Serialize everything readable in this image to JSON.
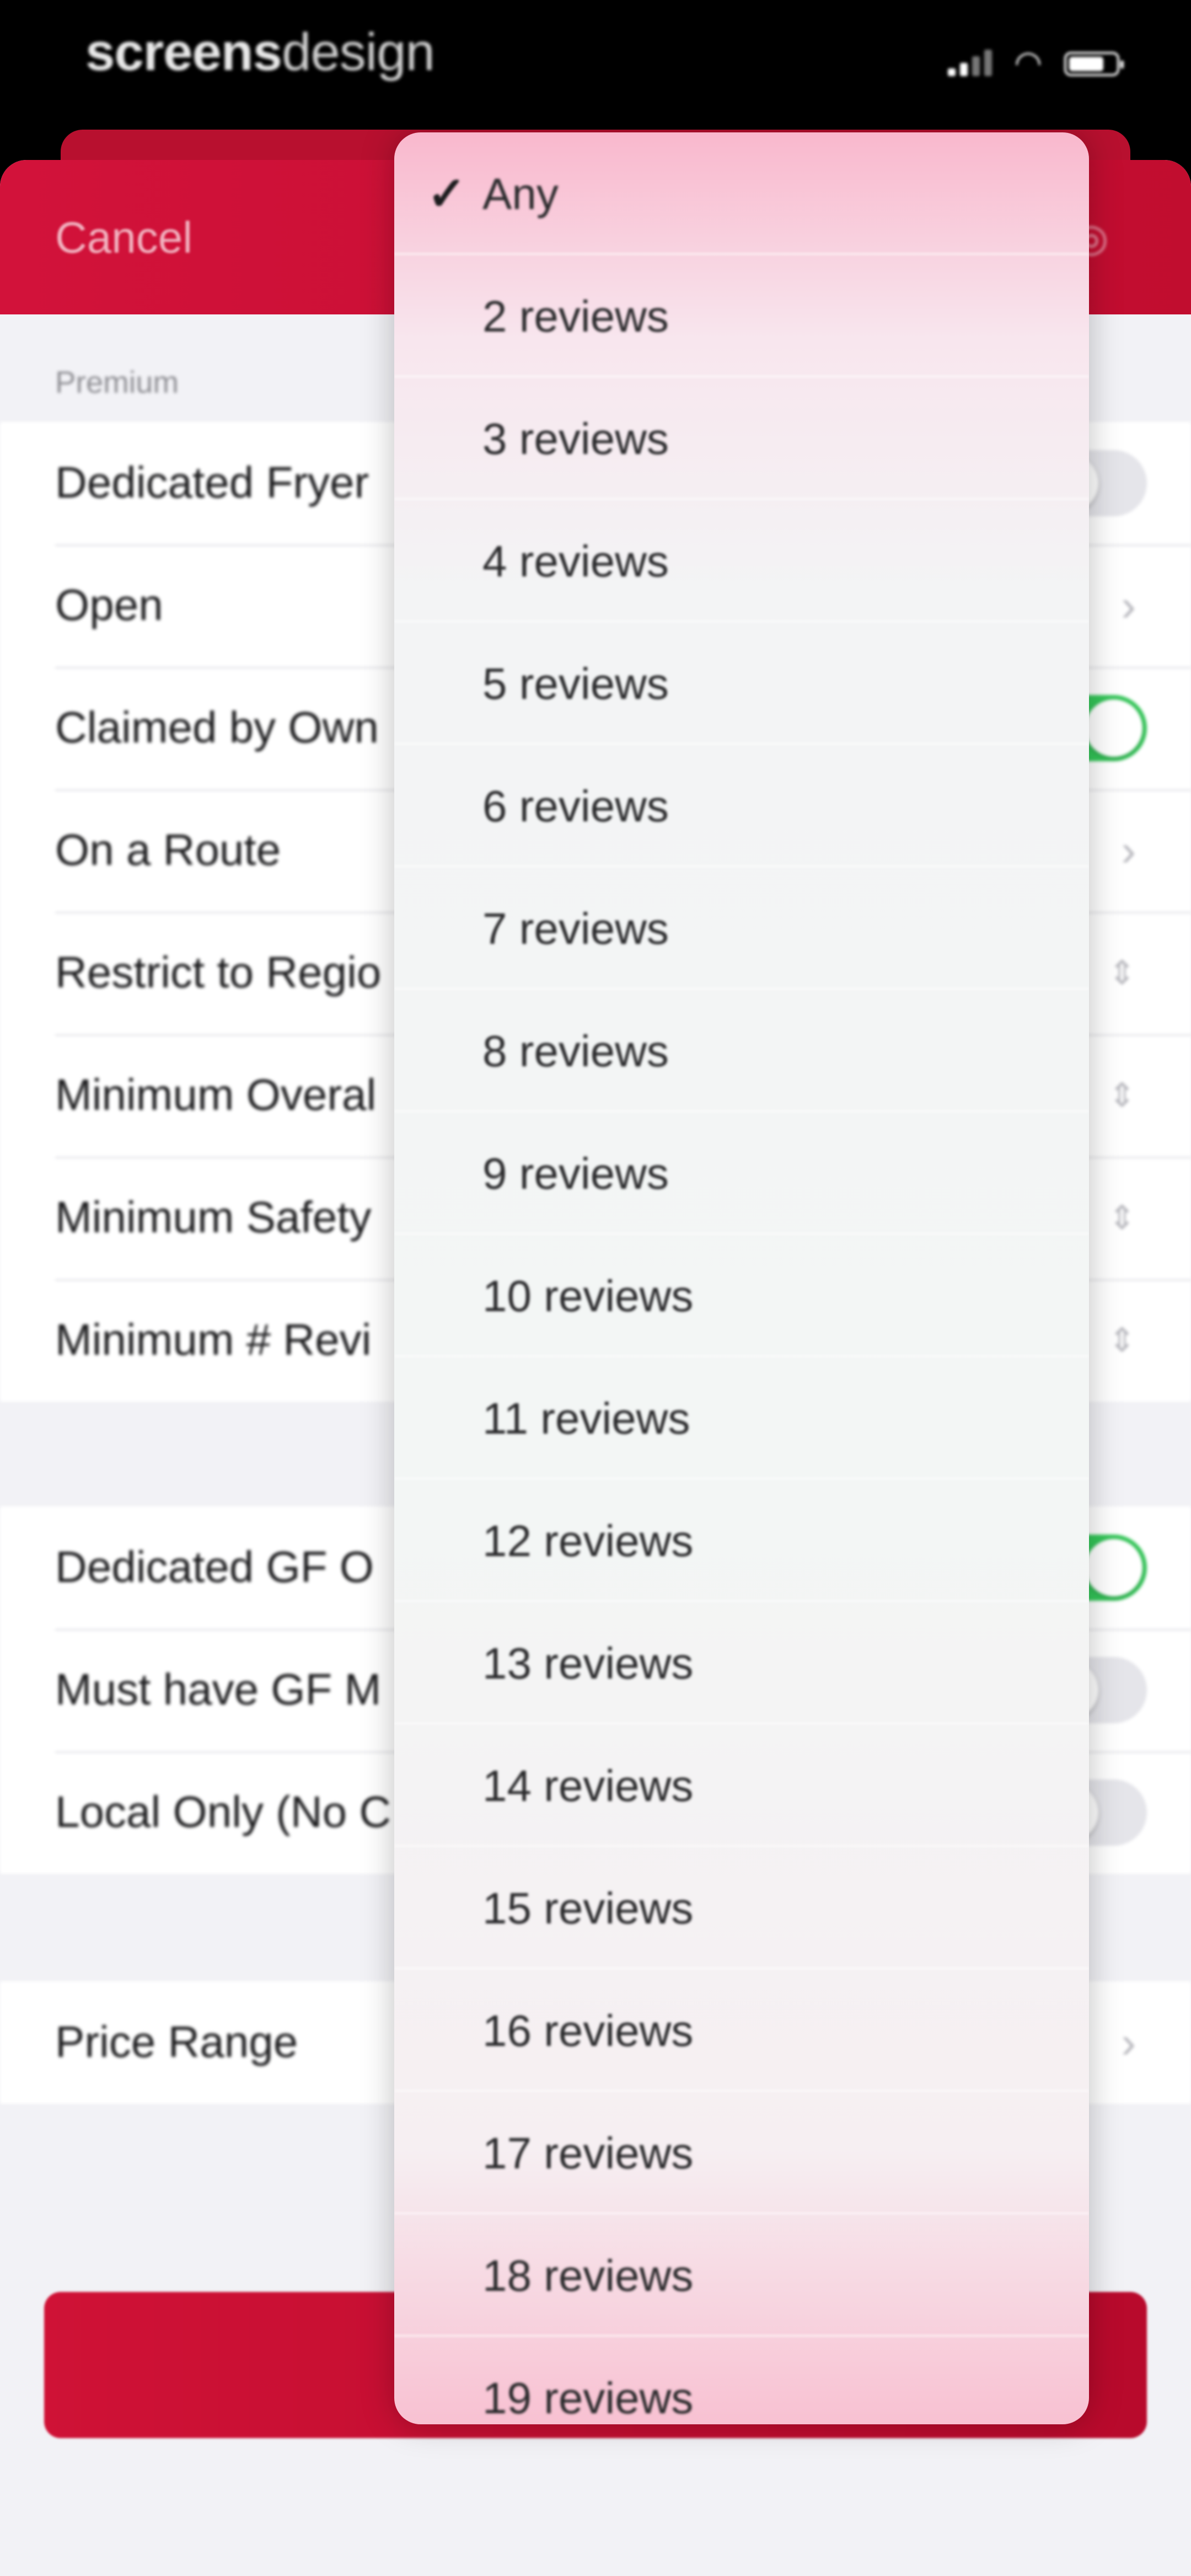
{
  "status_bar": {
    "brand_bold": "screens",
    "brand_light": "design",
    "signal_icon": "signal-bars-icon",
    "wifi_icon": "wifi-icon",
    "battery_icon": "battery-icon"
  },
  "nav": {
    "cancel_label": "Cancel",
    "right_icon": "close-icon",
    "color": "#c8102e"
  },
  "sections": {
    "premium_header": "Premium",
    "premium_rows": [
      {
        "label": "Dedicated Fryer",
        "accessory": "toggle",
        "on": false
      },
      {
        "label": "Open",
        "accessory": "chevron"
      },
      {
        "label": "Claimed by Own",
        "accessory": "toggle",
        "on": true
      },
      {
        "label": "On a Route",
        "accessory": "chevron"
      },
      {
        "label": "Restrict to Regio",
        "accessory": "stepper"
      },
      {
        "label": "Minimum Overal",
        "accessory": "stepper"
      },
      {
        "label": "Minimum Safety",
        "accessory": "stepper"
      },
      {
        "label": "Minimum # Revi",
        "accessory": "stepper"
      }
    ],
    "second_rows": [
      {
        "label": "Dedicated GF O",
        "accessory": "toggle",
        "on": true
      },
      {
        "label": "Must have GF M",
        "accessory": "toggle",
        "on": false
      },
      {
        "label": "Local Only (No C",
        "accessory": "toggle",
        "on": false
      }
    ],
    "third_rows": [
      {
        "label": "Price Range",
        "accessory": "chevron"
      }
    ]
  },
  "dropdown": {
    "selected_index": 0,
    "check_mark": "✓",
    "options": [
      "Any",
      "2 reviews",
      "3 reviews",
      "4 reviews",
      "5 reviews",
      "6 reviews",
      "7 reviews",
      "8 reviews",
      "9 reviews",
      "10 reviews",
      "11 reviews",
      "12 reviews",
      "13 reviews",
      "14 reviews",
      "15 reviews",
      "16 reviews",
      "17 reviews",
      "18 reviews",
      "19 reviews"
    ]
  },
  "colors": {
    "accent": "#c8102e",
    "toggle_on": "#34c759",
    "toggle_off": "#e5e5ea"
  }
}
